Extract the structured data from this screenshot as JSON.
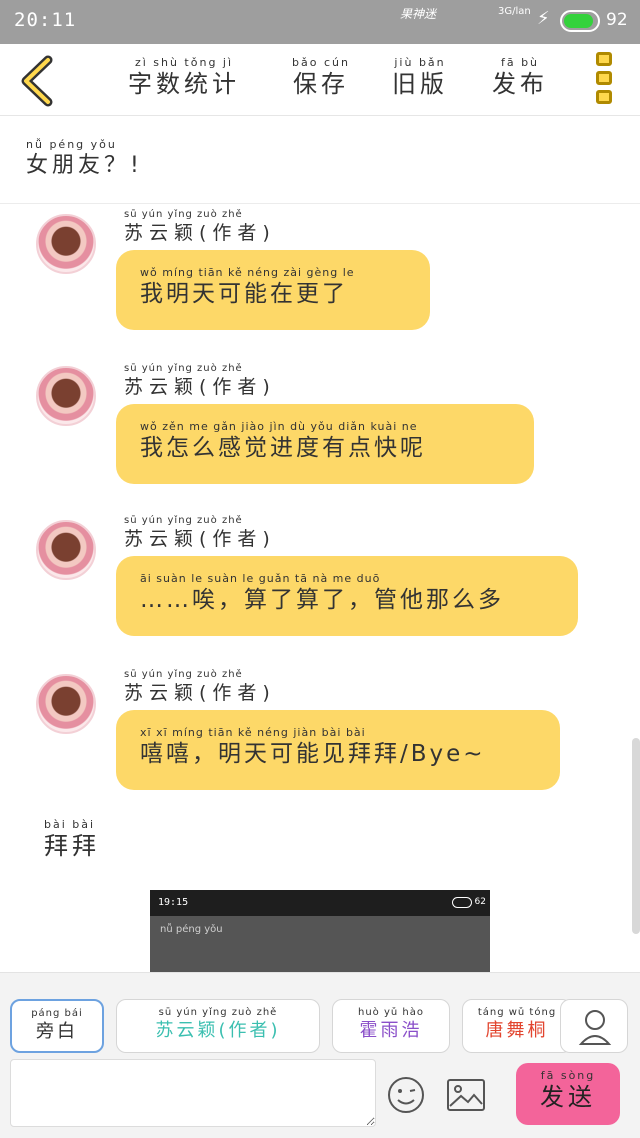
{
  "status_bar": {
    "time": "20:11",
    "carrier_logo_text": "果神迷",
    "network": "3G/lan",
    "battery_level": "92",
    "battery_fraction": 0.92,
    "battery_color": "#34d23c"
  },
  "toolbar": {
    "back_icon": "chevron-left-icon",
    "buttons": [
      {
        "pinyin": "zì shù tǒng jì",
        "label": "字数统计"
      },
      {
        "pinyin": "bǎo cún",
        "label": "保存"
      },
      {
        "pinyin": "jiù bǎn",
        "label": "旧版"
      },
      {
        "pinyin": "fā bù",
        "label": "发布"
      }
    ],
    "menu_icon": "menu-icon"
  },
  "story": {
    "title_pinyin": "nǚ péng yǒu",
    "title": "女朋友？!"
  },
  "messages": [
    {
      "sender_pinyin": "sū yún yǐng  zuò zhě",
      "sender": "苏云颖(作者)",
      "pinyin": "wǒ míng tiān kě néng zài gèng le",
      "text": "我明天可能在更了"
    },
    {
      "sender_pinyin": "sū yún yǐng  zuò zhě",
      "sender": "苏云颖(作者)",
      "pinyin": "wǒ zěn me gǎn jiào jìn dù yǒu diǎn kuài ne",
      "text": "我怎么感觉进度有点快呢"
    },
    {
      "sender_pinyin": "sū yún yǐng  zuò zhě",
      "sender": "苏云颖(作者)",
      "pinyin": "āi suàn le suàn le guǎn tā nà me duō",
      "text": "……唉，算了算了，管他那么多"
    },
    {
      "sender_pinyin": "sū yún yǐng  zuò zhě",
      "sender": "苏云颖(作者)",
      "pinyin": "xī xī míng tiān kě néng jiàn bài bài",
      "text": "嘻嘻，明天可能见拜拜/Bye~"
    }
  ],
  "narration": {
    "pinyin": "bài bài",
    "text": "拜拜"
  },
  "embedded_screenshot": {
    "time": "19:15",
    "battery": "62",
    "line": "nǚ péng yǒu"
  },
  "bottom": {
    "roles": [
      {
        "pinyin": "páng bái",
        "label": "旁白",
        "color": "#333333",
        "active": true
      },
      {
        "pinyin": "sū yún yǐng  zuò zhě",
        "label": "苏云颖(作者)",
        "color": "#3bbfb0",
        "active": false
      },
      {
        "pinyin": "huò yǔ hào",
        "label": "霍雨浩",
        "color": "#8a4fc9",
        "active": false
      },
      {
        "pinyin": "táng wǔ tóng",
        "label": "唐舞桐",
        "color": "#e2452f",
        "active": false
      }
    ],
    "input_placeholder": "",
    "send_pinyin": "fā sòng",
    "send_label": "发送",
    "send_color": "#f3649a"
  }
}
